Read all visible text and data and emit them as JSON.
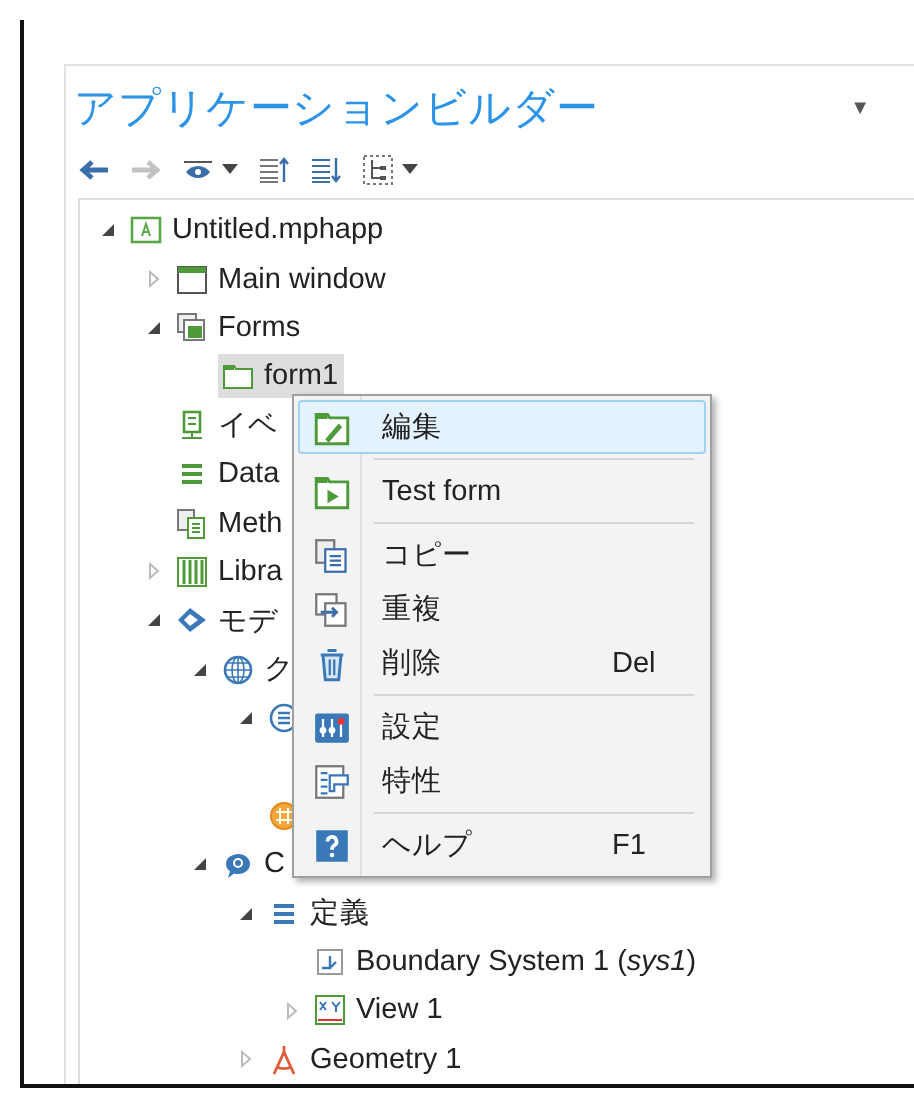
{
  "panel": {
    "title": "アプリケーションビルダー",
    "title_menu": "▼"
  },
  "toolbar": [
    {
      "kind": "back",
      "disabled": false,
      "caret": false
    },
    {
      "kind": "forward",
      "disabled": true,
      "caret": false
    },
    {
      "kind": "eye",
      "disabled": false,
      "caret": true
    },
    {
      "kind": "move-up",
      "disabled": false,
      "caret": false
    },
    {
      "kind": "move-down",
      "disabled": false,
      "caret": false
    },
    {
      "kind": "tree",
      "disabled": false,
      "caret": true
    }
  ],
  "tree": [
    {
      "label": "Untitled.mphapp",
      "kind": "app",
      "expanded": true,
      "selected": false,
      "children": [
        {
          "label": "Main window",
          "kind": "window",
          "expanded": false,
          "selected": false
        },
        {
          "label": "Forms",
          "kind": "forms",
          "expanded": true,
          "selected": false,
          "children": [
            {
              "label": "form1",
              "kind": "form",
              "selected": true
            }
          ]
        },
        {
          "label": "イベ",
          "kind": "events",
          "selected": false
        },
        {
          "label": "Data",
          "kind": "data",
          "selected": false
        },
        {
          "label": "Meth",
          "kind": "methods",
          "selected": false
        },
        {
          "label": "Libra",
          "kind": "library",
          "expanded": false,
          "selected": false
        },
        {
          "label": "モデ",
          "kind": "model",
          "expanded": true,
          "selected": false,
          "children": [
            {
              "label": "ク",
              "kind": "globe",
              "expanded": true,
              "selected": false,
              "children": [
                {
                  "kind": "list",
                  "expanded": true,
                  "children": [
                    {
                      "kind": "blank"
                    }
                  ]
                },
                {
                  "kind": "material"
                }
              ]
            },
            {
              "label": "C",
              "kind": "component",
              "expanded": true,
              "selected": false,
              "children": [
                {
                  "label": "定義",
                  "kind": "definitions",
                  "expanded": true,
                  "selected": false,
                  "children": [
                    {
                      "label": "Boundary System 1 (*sys1*)",
                      "kind": "boundary",
                      "selected": false
                    },
                    {
                      "label": "View 1",
                      "kind": "view",
                      "expanded": false,
                      "selected": false
                    }
                  ]
                },
                {
                  "label": "Geometry 1",
                  "kind": "geometry",
                  "expanded": false,
                  "selected": false
                }
              ]
            }
          ]
        }
      ]
    }
  ],
  "context_menu": [
    {
      "kind": "edit",
      "label": "編集",
      "selected": true
    },
    {
      "kind": "separator"
    },
    {
      "kind": "test",
      "label": "Test form",
      "selected": false
    },
    {
      "kind": "separator"
    },
    {
      "kind": "copy",
      "label": "コピー",
      "selected": false
    },
    {
      "kind": "duplicate",
      "label": "重複",
      "selected": false
    },
    {
      "kind": "delete",
      "label": "削除",
      "shortcut": "Del",
      "selected": false
    },
    {
      "kind": "separator"
    },
    {
      "kind": "settings",
      "label": "設定",
      "selected": false
    },
    {
      "kind": "properties",
      "label": "特性",
      "selected": false
    },
    {
      "kind": "separator"
    },
    {
      "kind": "help",
      "label": "ヘルプ",
      "shortcut": "F1",
      "selected": false
    }
  ]
}
